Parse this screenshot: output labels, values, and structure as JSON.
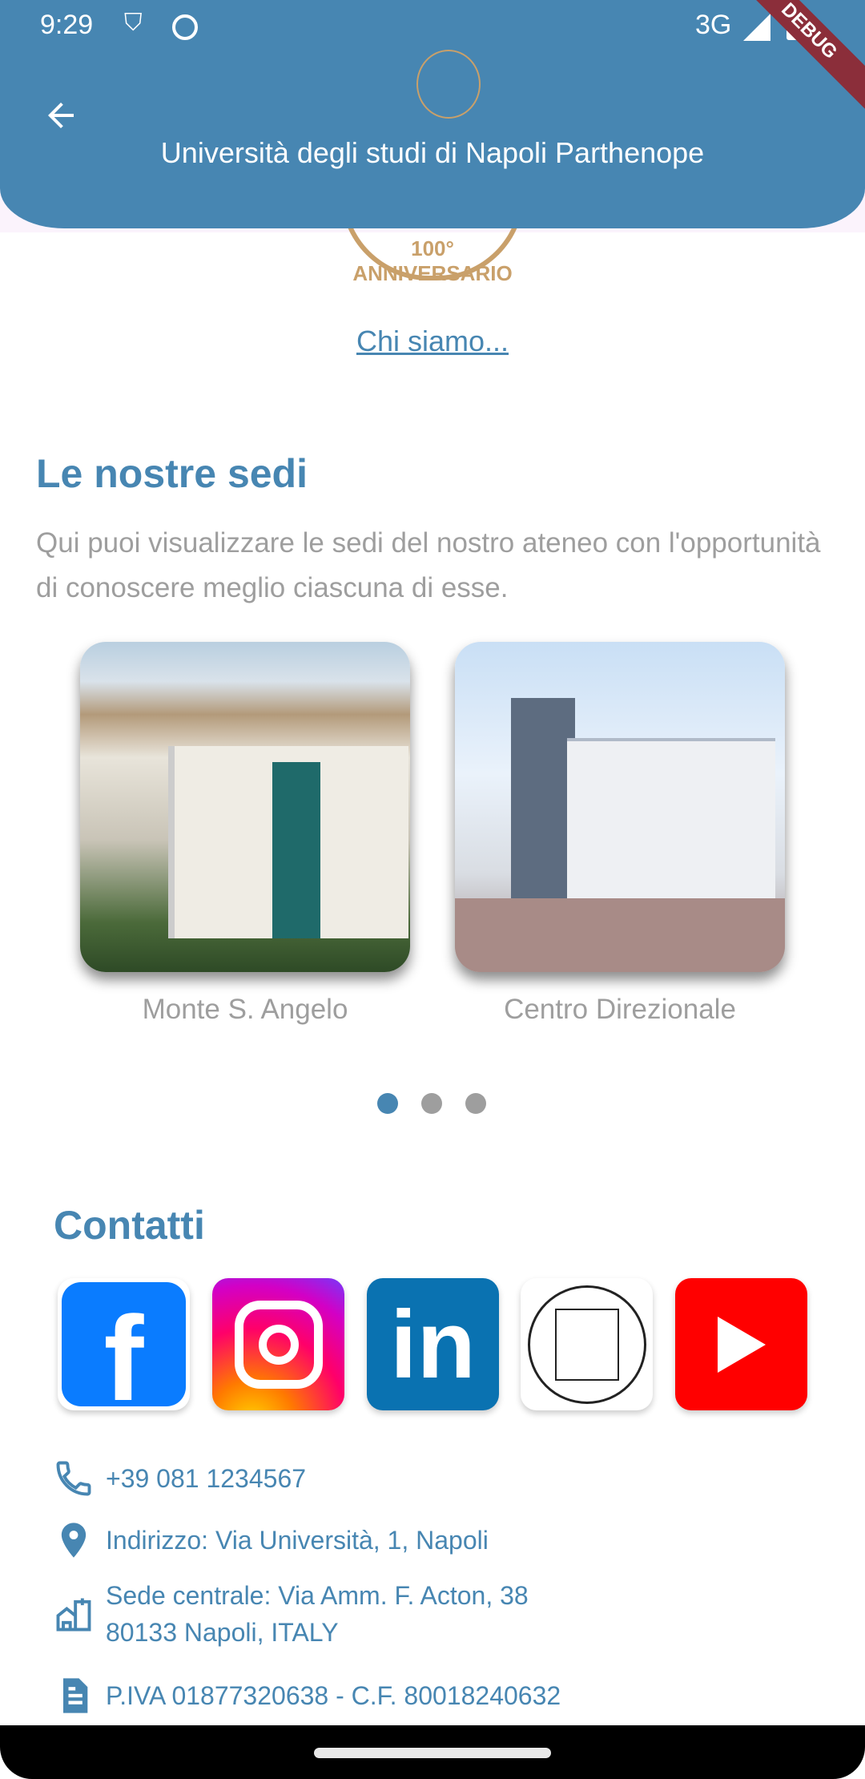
{
  "status_bar": {
    "time": "9:29",
    "network": "3G"
  },
  "debug_banner": "DEBUG",
  "app_bar": {
    "title": "Università degli studi di Napoli Parthenope"
  },
  "logo": {
    "text": "100° ANNIVERSARIO"
  },
  "about_link": "Chi siamo...",
  "sedi": {
    "title": "Le nostre sedi",
    "description": "Qui puoi visualizzare le sedi del nostro ateneo con l'opportunità di conoscere meglio ciascuna di esse.",
    "items": [
      {
        "label": "Monte S. Angelo"
      },
      {
        "label": "Centro Direzionale"
      }
    ],
    "pagination": {
      "total": 3,
      "active": 0
    }
  },
  "contatti": {
    "title": "Contatti",
    "socials": [
      "facebook",
      "instagram",
      "linkedin",
      "university-website",
      "youtube"
    ],
    "phone": "+39 081 1234567",
    "address": "Indirizzo: Via Università, 1, Napoli",
    "hq_line1": "Sede centrale: Via Amm. F. Acton, 38",
    "hq_line2": "80133 Napoli, ITALY",
    "tax": "P.IVA 01877320638 - C.F. 80018240632"
  },
  "colors": {
    "primary": "#4786B2",
    "muted": "#9e9e9e"
  }
}
